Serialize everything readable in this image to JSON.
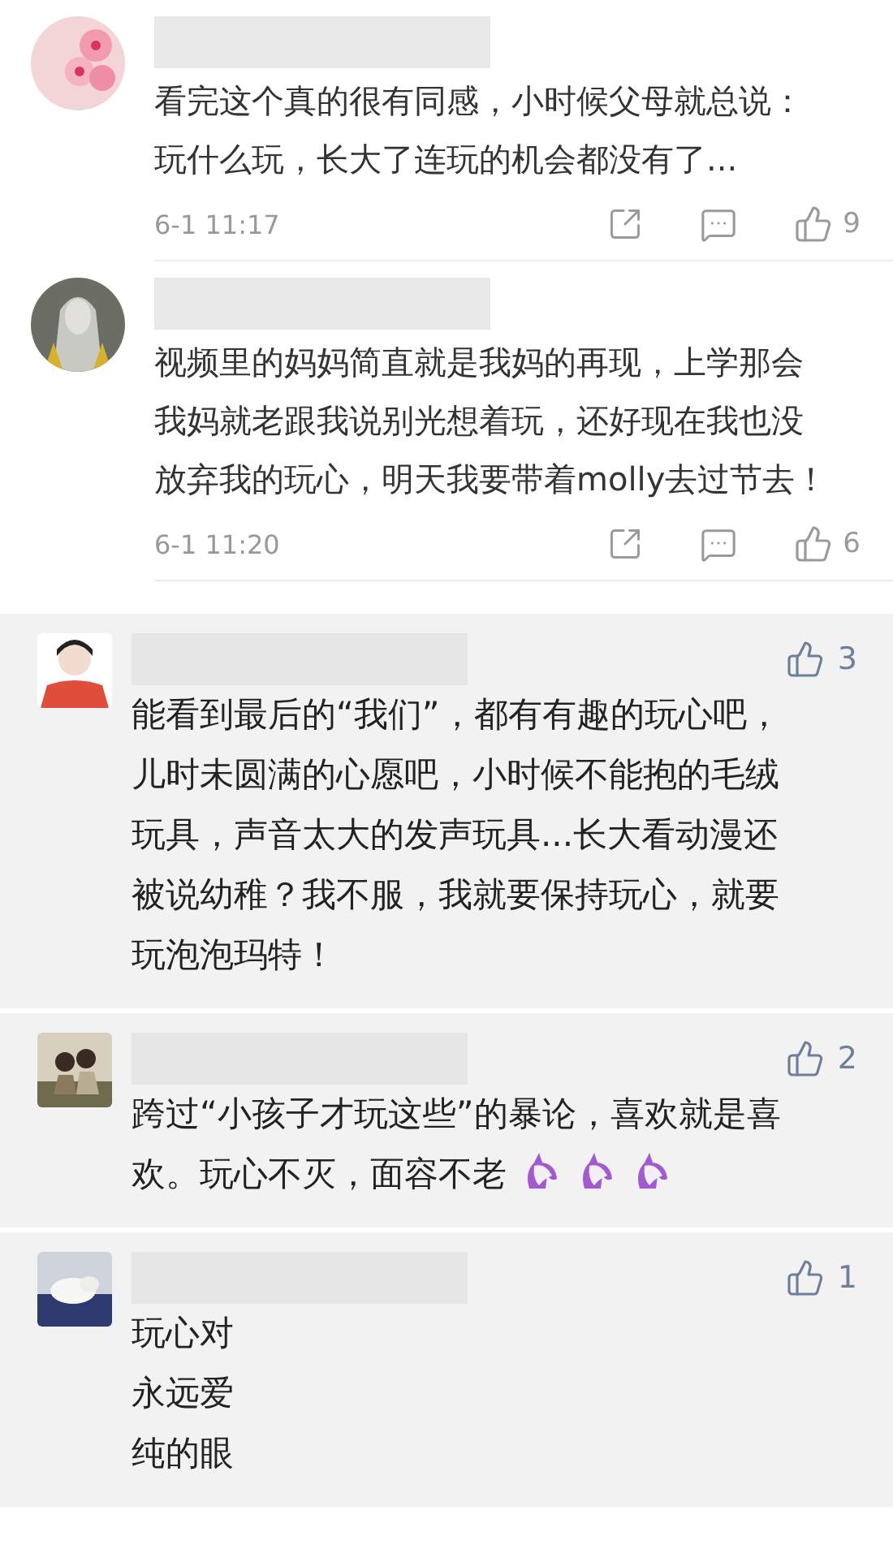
{
  "comments": [
    {
      "time": "6-1 11:17",
      "likes": "9",
      "text": "看完这个真的很有同感，小时候父母就总说：玩什么玩，长大了连玩的机会都没有了..."
    },
    {
      "time": "6-1 11:20",
      "likes": "6",
      "text": "视频里的妈妈简直就是我妈的再现，上学那会我妈就老跟我说别光想着玩，还好现在我也没放弃我的玩心，明天我要带着molly去过节去！"
    }
  ],
  "featured_comments": [
    {
      "kind": "plain",
      "likes": "3",
      "lines": [
        "能看到最后的“我们”，都有有趣的玩心吧，儿时未圆满的心愿吧，小时候不能抱的毛绒玩具，声音太大的发声玩具...长大看动漫还被说幼稚？我不服，我就要保持玩心，就要玩泡泡玛特！"
      ]
    },
    {
      "kind": "unicorns",
      "likes": "2",
      "lines": [
        "跨过“小孩子才玩这些”的暴论，喜欢就是喜欢。玩心不灭，面容不老"
      ]
    },
    {
      "kind": "plain",
      "likes": "1",
      "lines": [
        "玩心对",
        "永远爱",
        "纯的眼"
      ]
    }
  ]
}
